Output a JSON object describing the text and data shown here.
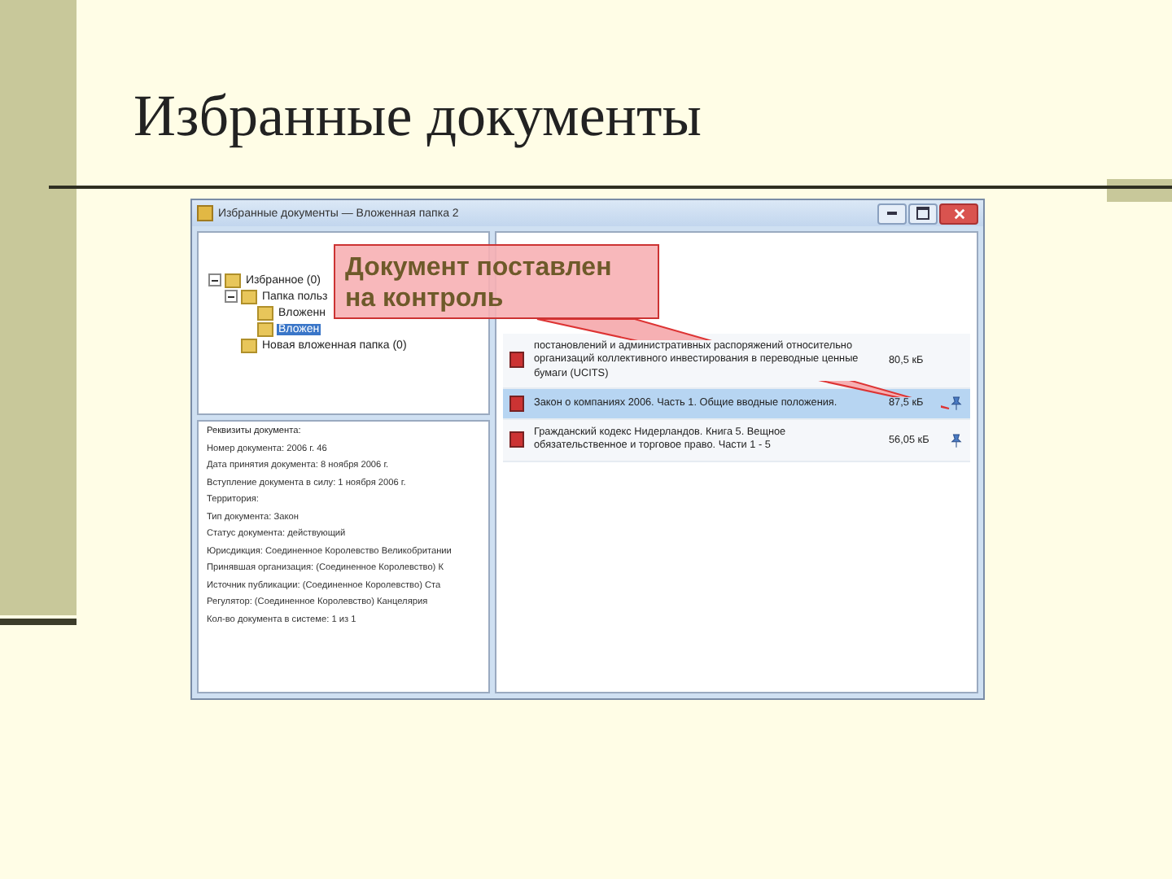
{
  "slide": {
    "title": "Избранные документы"
  },
  "window": {
    "title": "Избранные документы — Вложенная папка 2"
  },
  "tree": [
    {
      "label": "Избранное (0)",
      "expanded": true,
      "selected": false,
      "children": [
        {
          "label": "Папка польз",
          "expanded": true,
          "selected": false,
          "children": [
            {
              "label": "Вложенн",
              "selected": false
            },
            {
              "label": "Вложен",
              "selected": true
            }
          ]
        },
        {
          "label": "Новая вложенная папка (0)",
          "selected": false
        }
      ]
    }
  ],
  "properties": {
    "heading": "Реквизиты документа:",
    "lines": [
      "Номер документа: 2006 г. 46",
      "Дата принятия документа: 8 ноября 2006 г.",
      "Вступление документа в силу: 1 ноября 2006 г.",
      "Территория:",
      "Тип документа: Закон",
      "Статус документа: действующий",
      "Юрисдикция: Соединенное Королевство Великобритании",
      "Принявшая организация: (Соединенное Королевство) К",
      "Источник публикации: (Соединенное Королевство) Ста",
      "Регулятор: (Соединенное Королевство) Канцелярия",
      "Кол-во документа в системе: 1 из 1"
    ]
  },
  "documents": {
    "rows": [
      {
        "title": "постановлений и административных распоряжений относительно организаций коллективного инвестирования в переводные ценные бумаги (UCITS)",
        "size": "80,5 кБ",
        "selected": false,
        "pinned": false
      },
      {
        "title": "Закон о компаниях 2006. Часть 1. Общие вводные положения.",
        "size": "87,5 кБ",
        "selected": true,
        "pinned": true
      },
      {
        "title": "Гражданский кодекс Нидерландов. Книга 5. Вещное обязательственное и торговое право. Части 1 - 5",
        "size": "56,05 кБ",
        "selected": false,
        "pinned": true
      }
    ]
  },
  "callout": {
    "text": "Документ поставлен на контроль"
  }
}
